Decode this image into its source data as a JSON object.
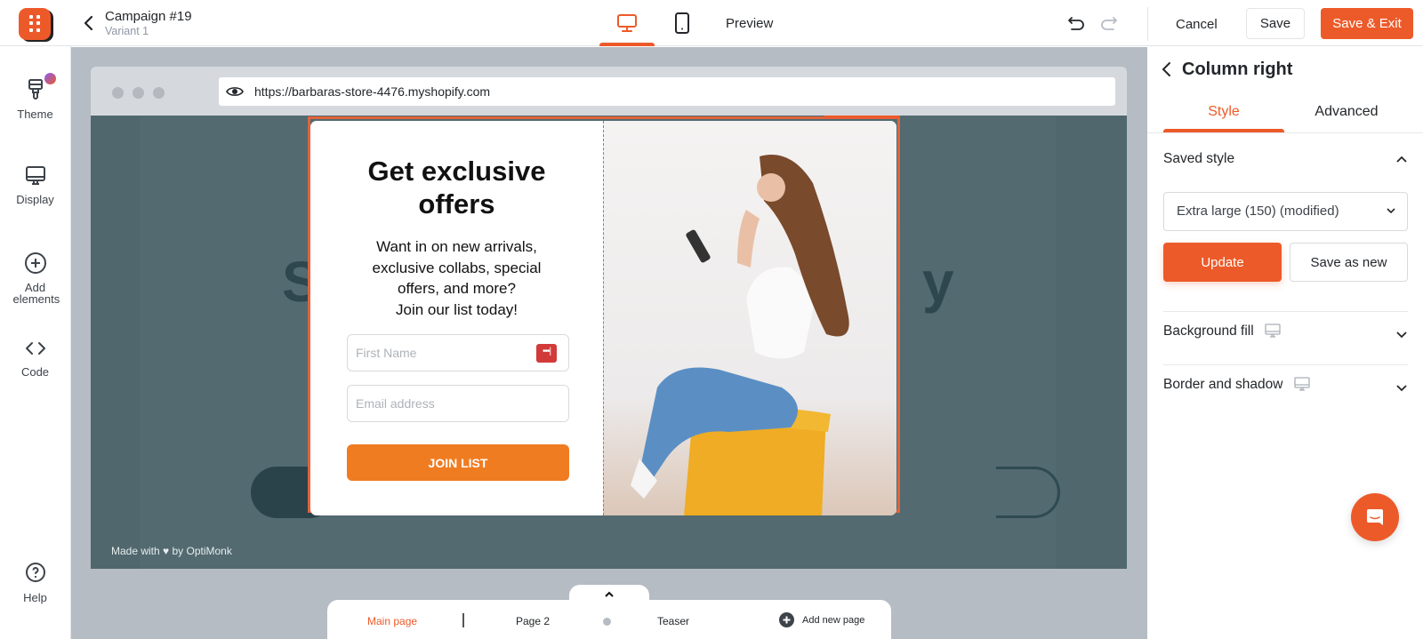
{
  "header": {
    "campaign_title": "Campaign #19",
    "variant": "Variant 1",
    "preview_label": "Preview",
    "cancel_label": "Cancel",
    "save_label": "Save",
    "save_exit_label": "Save & Exit",
    "active_device": "desktop"
  },
  "sidebar": {
    "items": [
      {
        "label": "Theme",
        "icon": "paint-brush-icon"
      },
      {
        "label": "Display",
        "icon": "monitor-icon"
      },
      {
        "label": "Add elements",
        "icon": "plus-circle-icon"
      },
      {
        "label": "Code",
        "icon": "code-icon"
      },
      {
        "label": "Help",
        "icon": "help-circle-icon"
      }
    ]
  },
  "browser": {
    "url": "https://barbaras-store-4476.myshopify.com"
  },
  "site": {
    "ghost_left": "S",
    "ghost_right": "y",
    "made_with": "Made with ♥ by OptiMonk"
  },
  "popup": {
    "headline_line1": "Get exclusive",
    "headline_line2": "offers",
    "body_lines": [
      "Want in on new arrivals,",
      "exclusive collabs, special",
      "offers, and more?",
      "Join our list today!"
    ],
    "first_name_placeholder": "First Name",
    "email_placeholder": "Email address",
    "button_label": "JOIN LIST"
  },
  "pages": {
    "items": [
      {
        "label": "Main page",
        "active": true
      },
      {
        "label": "Page 2",
        "active": false
      },
      {
        "label": "Teaser",
        "active": false
      }
    ],
    "add_label": "Add new page"
  },
  "panel": {
    "title": "Column right",
    "tabs": [
      {
        "label": "Style",
        "active": true
      },
      {
        "label": "Advanced",
        "active": false
      }
    ],
    "saved_style_title": "Saved style",
    "saved_style_value": "Extra large (150) (modified)",
    "update_label": "Update",
    "save_as_new_label": "Save as new",
    "sections": [
      "Background fill",
      "Border and shadow"
    ]
  },
  "colors": {
    "accent": "#ed5a29",
    "popup_button": "#f07c22",
    "site_bg": "#4f676d"
  }
}
